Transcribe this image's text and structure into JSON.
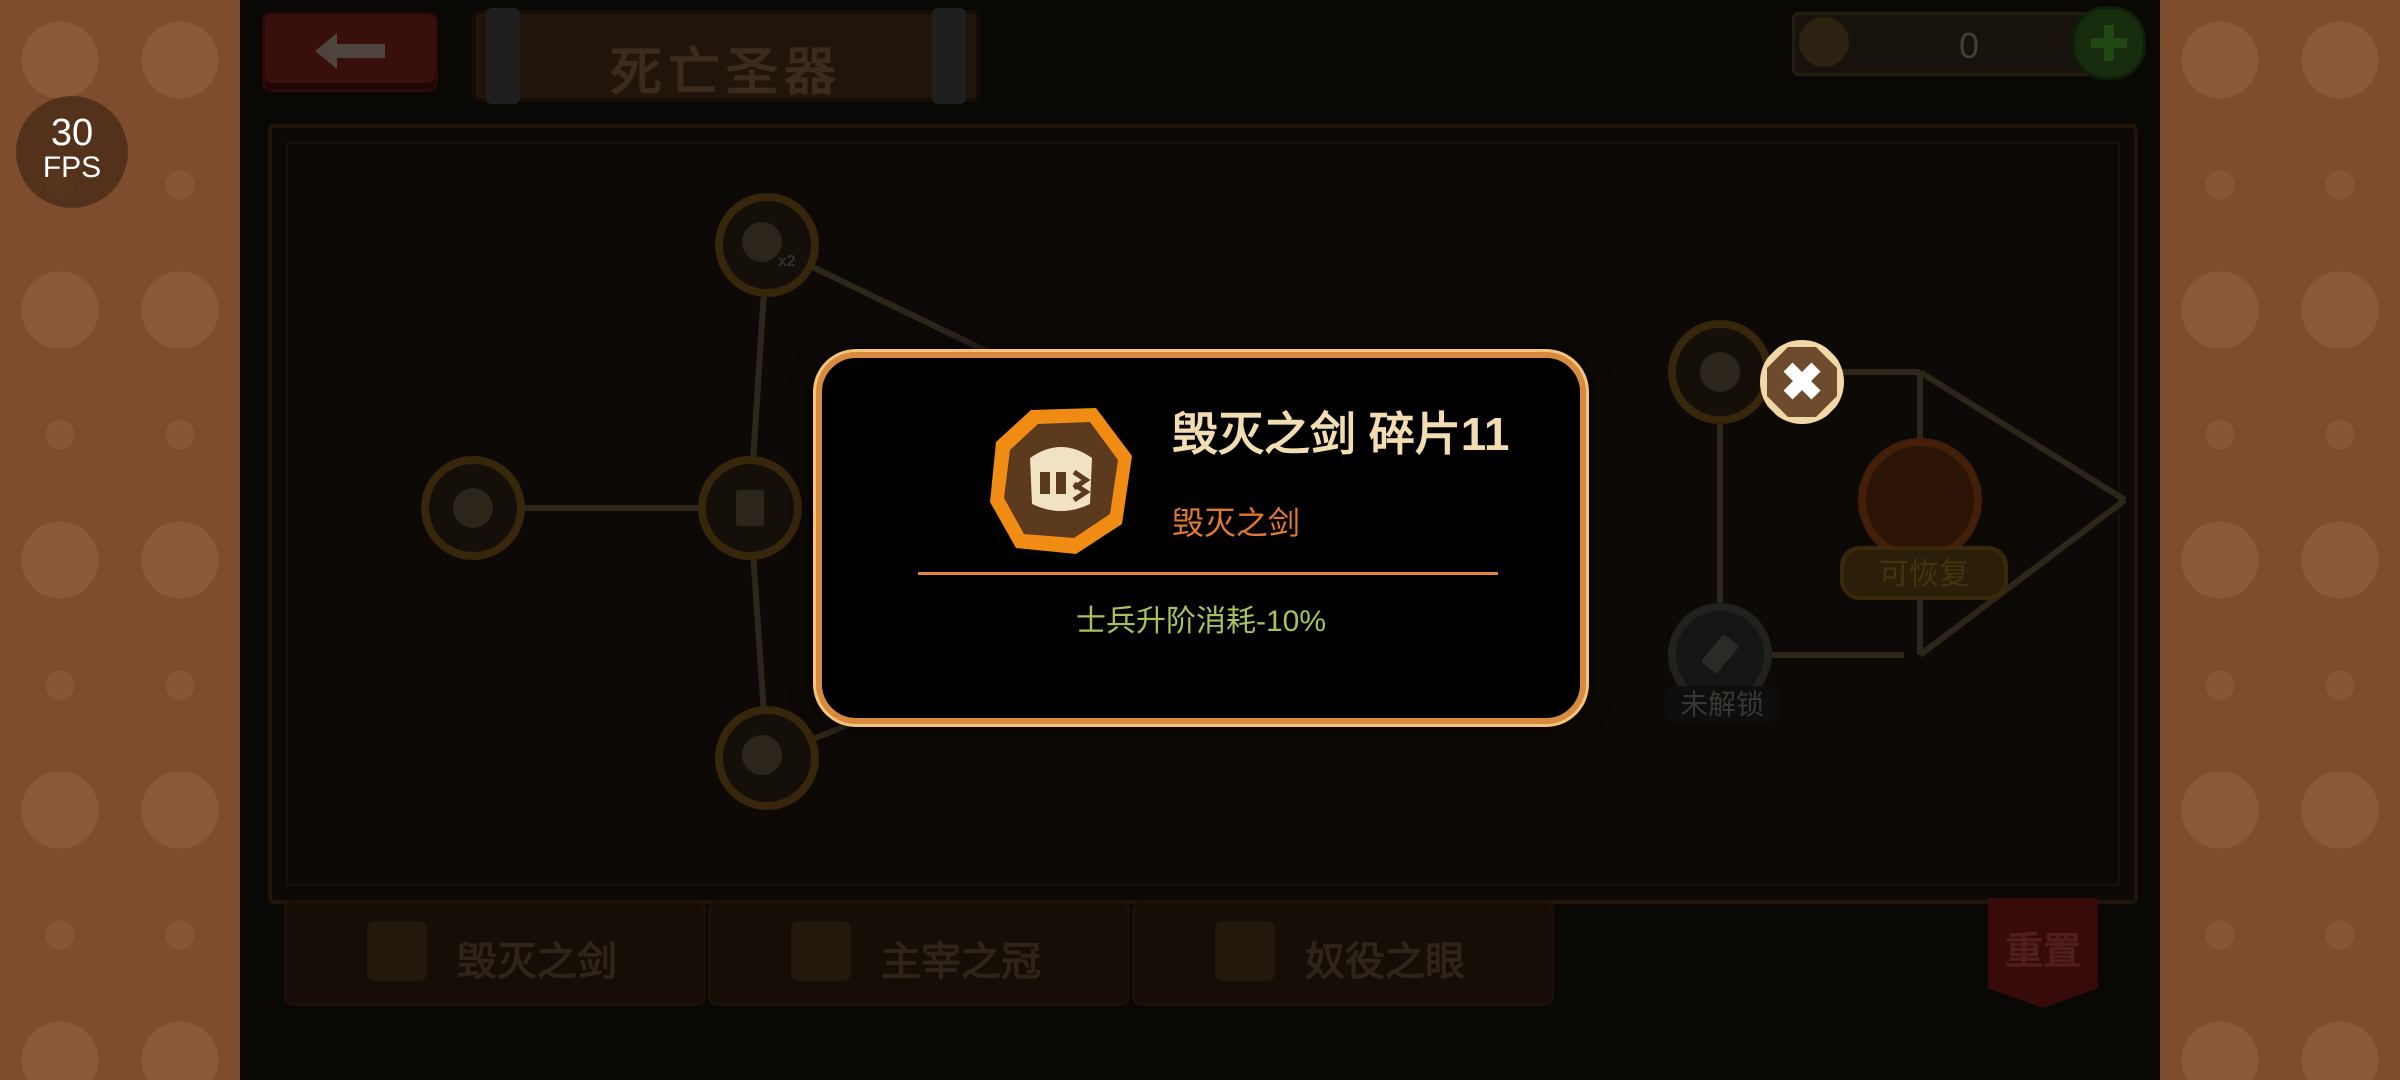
{
  "fps": {
    "value": "30",
    "label": "FPS"
  },
  "header": {
    "title": "死亡圣器",
    "currency_value": "0"
  },
  "tree": {
    "locked_label": "未解锁",
    "node_badge": "x2",
    "active_node_label": "可恢复"
  },
  "tabs": [
    {
      "label": "毁灭之剑"
    },
    {
      "label": "主宰之冠"
    },
    {
      "label": "奴役之眼"
    }
  ],
  "reset_label": "重置",
  "modal": {
    "title": "毁灭之剑 碎片11",
    "subtitle": "毁灭之剑",
    "effect": "士兵升阶消耗-10%"
  },
  "colors": {
    "accent_orange": "#e1782f",
    "modal_border": "#d88a3e",
    "effect_green": "#a7c25a",
    "title_cream": "#f2ddb2"
  },
  "icons": {
    "back": "arrow-left-icon",
    "currency": "skull-coin-icon",
    "add": "plus-icon",
    "close": "close-icon",
    "fragment": "helmet-icon"
  }
}
